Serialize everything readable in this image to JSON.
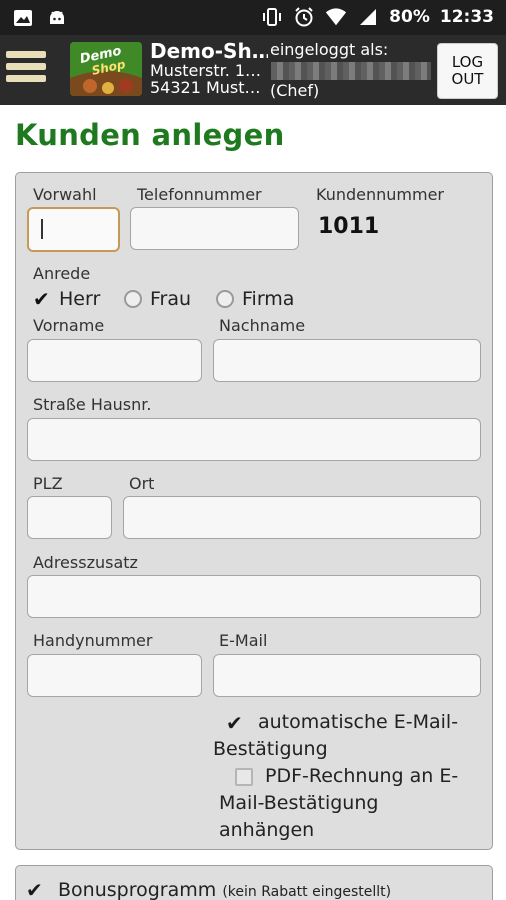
{
  "status_bar": {
    "battery": "80%",
    "time": "12:33"
  },
  "header": {
    "shop_name": "Demo-Sh…",
    "address_line1": "Musterstr. 1…",
    "address_line2": "54321 Must…",
    "login_label": "eingeloggt als:",
    "role": "(Chef)",
    "logout_line1": "LOG",
    "logout_line2": "OUT",
    "logo_text1": "Demo",
    "logo_text2": "Shop"
  },
  "page": {
    "title": "Kunden anlegen"
  },
  "form": {
    "vorwahl_label": "Vorwahl",
    "telefon_label": "Telefonnummer",
    "kundennummer_label": "Kundennummer",
    "kundennummer_value": "1011",
    "anrede_label": "Anrede",
    "anrede_options": [
      "Herr",
      "Frau",
      "Firma"
    ],
    "vorname_label": "Vorname",
    "nachname_label": "Nachname",
    "strasse_label": "Straße Hausnr.",
    "plz_label": "PLZ",
    "ort_label": "Ort",
    "adresszusatz_label": "Adresszusatz",
    "handy_label": "Handynummer",
    "email_label": "E-Mail",
    "auto_email_line1": "automatische E-Mail-",
    "auto_email_line2": "Bestätigung",
    "pdf_line1": "PDF-Rechnung an E-",
    "pdf_line2": "Mail-Bestätigung",
    "pdf_line3": "anhängen"
  },
  "bonus": {
    "label": "Bonusprogramm",
    "note": "(kein Rabatt eingestellt)"
  }
}
